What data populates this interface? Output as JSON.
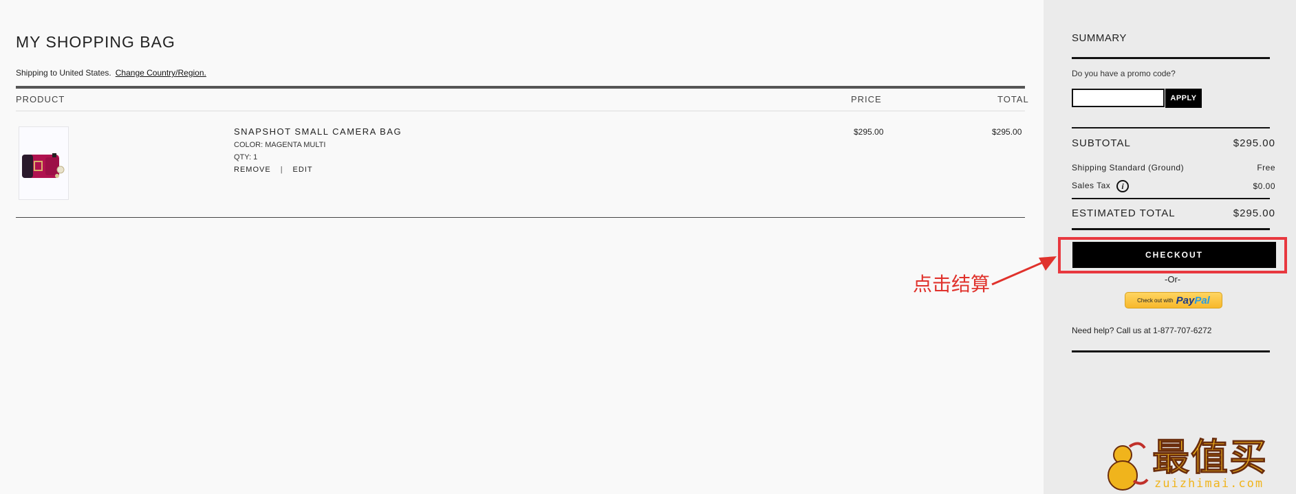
{
  "page": {
    "title": "MY SHOPPING BAG",
    "shipping_text": "Shipping to United States.",
    "change_link": "Change Country/Region."
  },
  "table": {
    "headers": {
      "product": "PRODUCT",
      "price": "PRICE",
      "total": "TOTAL"
    },
    "rows": [
      {
        "name": "SNAPSHOT SMALL CAMERA BAG",
        "color": "COLOR: MAGENTA MULTI",
        "qty": "QTY: 1",
        "remove": "REMOVE",
        "separator": "|",
        "edit": "EDIT",
        "price": "$295.00",
        "total": "$295.00"
      }
    ]
  },
  "summary": {
    "title": "SUMMARY",
    "promo_question": "Do you have a promo code?",
    "promo_placeholder": "",
    "apply_label": "APPLY",
    "subtotal_label": "SUBTOTAL",
    "subtotal_value": "$295.00",
    "shipping_label": "Shipping Standard (Ground)",
    "shipping_value": "Free",
    "tax_label": "Sales Tax",
    "tax_icon": "i",
    "tax_value": "$0.00",
    "estimated_label": "ESTIMATED TOTAL",
    "estimated_value": "$295.00",
    "checkout_label": "CHECKOUT",
    "or_text": "-Or-",
    "paypal_prefix": "Check out with",
    "paypal_logo_a": "Pay",
    "paypal_logo_b": "Pal",
    "help_text": "Need help? Call us at 1-877-707-6272"
  },
  "annotation": {
    "text": "点击结算",
    "color": "#e0322c"
  },
  "watermark": {
    "main": "最值买",
    "sub": "zuizhimai.com"
  },
  "colors": {
    "accent_black": "#000000",
    "highlight_red": "#e8383f",
    "paypal_yellow": "#f7b82b"
  }
}
